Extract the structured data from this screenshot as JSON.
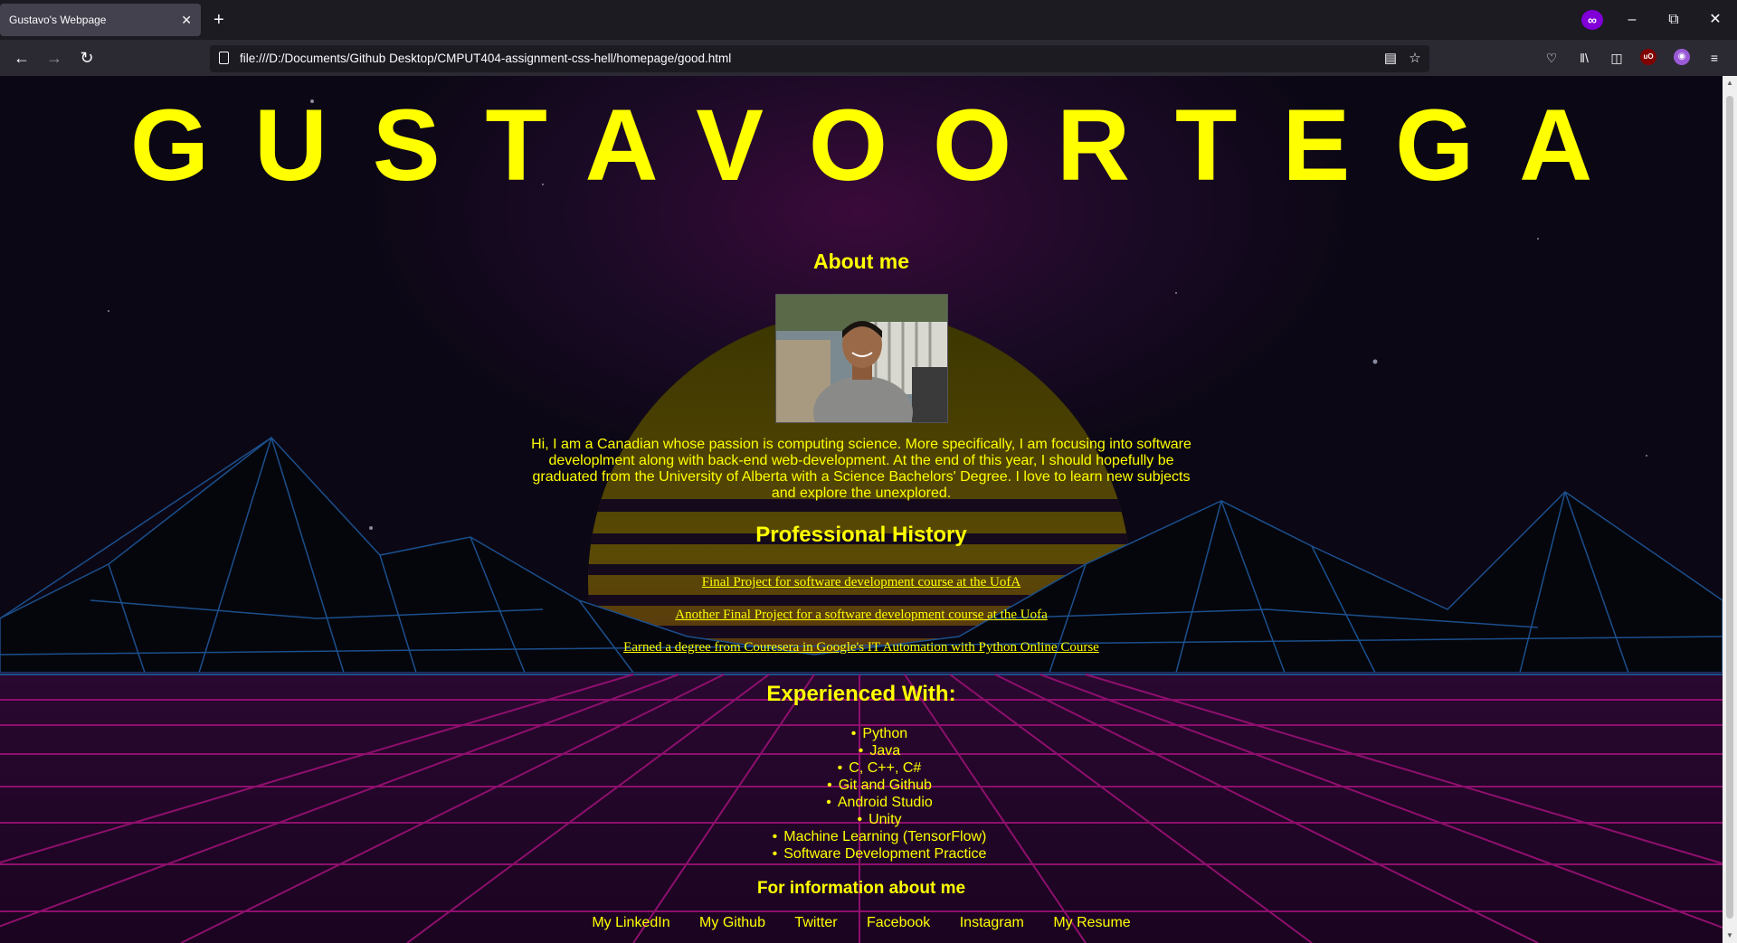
{
  "browser": {
    "tab_title": "Gustavo's Webpage",
    "tab_close": "✕",
    "new_tab": "+",
    "url": "file:///D:/Documents/Github Desktop/CMPUT404-assignment-css-hell/homepage/good.html",
    "private_badge": "∞",
    "ublock_badge": "uO"
  },
  "page": {
    "title": "GUSTAVOORTEGA",
    "about_heading": "About me",
    "about_text": "Hi, I am a Canadian whose passion is computing science. More specifically, I am focusing into software developlment along with back-end web-development. At the end of this year, I should hopefully be graduated from the University of Alberta with a Science Bachelors' Degree. I love to learn new subjects and explore the unexplored.",
    "professional_heading": "Professional History",
    "projects": [
      "Final Project for software development course at the UofA",
      "Another Final Project for a software development course at the Uofa",
      "Earned a degree from Couresera in Google's IT Automation with Python Online Course"
    ],
    "experience_heading": "Experienced With:",
    "skills": [
      "Python",
      "Java",
      "C, C++, C#",
      "Git and Github",
      "Android Studio",
      "Unity",
      "Machine Learning (TensorFlow)",
      "Software Development Practice"
    ],
    "info_heading": "For information about me",
    "social_links": [
      "My LinkedIn",
      "My Github",
      "Twitter",
      "Facebook",
      "Instagram",
      "My Resume"
    ]
  },
  "colors": {
    "text": "#ffff00",
    "sun_top": "#c8b400",
    "sun_bottom": "#c82050",
    "grid_floor": "#a0107a",
    "mountain_lines": "#1a4a8a"
  }
}
